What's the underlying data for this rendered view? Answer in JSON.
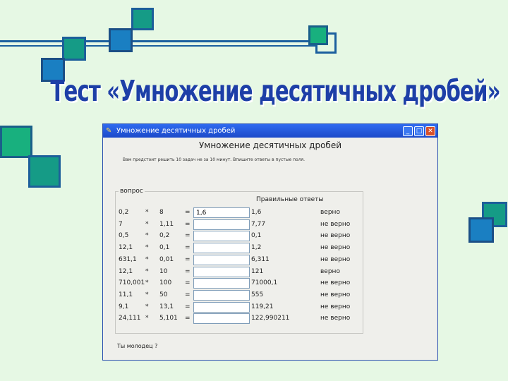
{
  "slide_title": "Тест «Умножение десятичных дробей»",
  "window": {
    "title": "Умножение десятичных дробей",
    "header": "Умножение десятичных дробей",
    "instructions": "Вам предстоит решить 10 задач не за 10 минут. Впишите ответы в пустые поля.",
    "group_label": "вопрос",
    "answers_label": "Правильные ответы",
    "bottom_text": "Ты молодец ?",
    "buttons": {
      "minimize": "_",
      "maximize": "□",
      "close": "✕"
    }
  },
  "rows": [
    {
      "a": "0,2",
      "op": "*",
      "b": "8",
      "eq": "=",
      "input": "1,6",
      "correct": "1,6",
      "status": "верно"
    },
    {
      "a": "7",
      "op": "*",
      "b": "1,11",
      "eq": "=",
      "input": "",
      "correct": "7,77",
      "status": "не верно"
    },
    {
      "a": "0,5",
      "op": "*",
      "b": "0,2",
      "eq": "=",
      "input": "",
      "correct": "0,1",
      "status": "не верно"
    },
    {
      "a": "12,1",
      "op": "*",
      "b": "0,1",
      "eq": "=",
      "input": "",
      "correct": "1,2",
      "status": "не верно"
    },
    {
      "a": "631,1",
      "op": "*",
      "b": "0,01",
      "eq": "=",
      "input": "",
      "correct": "6,311",
      "status": "не верно"
    },
    {
      "a": "12,1",
      "op": "*",
      "b": "10",
      "eq": "=",
      "input": "",
      "correct": "121",
      "status": "верно"
    },
    {
      "a": "710,001",
      "op": "*",
      "b": "100",
      "eq": "=",
      "input": "",
      "correct": "71000,1",
      "status": "не верно"
    },
    {
      "a": "11,1",
      "op": "*",
      "b": "50",
      "eq": "=",
      "input": "",
      "correct": "555",
      "status": "не верно"
    },
    {
      "a": "9,1",
      "op": "*",
      "b": "13,1",
      "eq": "=",
      "input": "",
      "correct": "119,21",
      "status": "не верно"
    },
    {
      "a": "24,111",
      "op": "*",
      "b": "5,101",
      "eq": "=",
      "input": "",
      "correct": "122,990211",
      "status": "не верно"
    }
  ]
}
